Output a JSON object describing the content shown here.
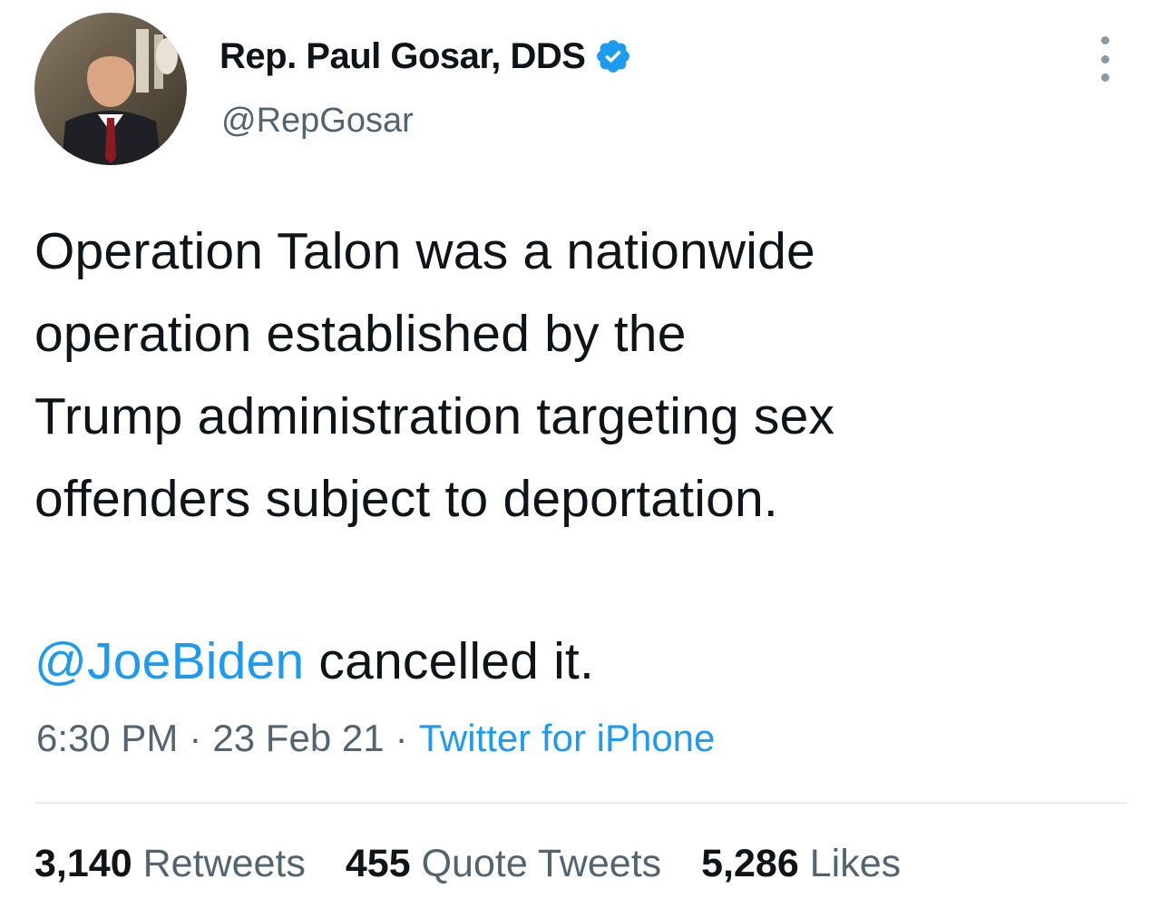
{
  "author": {
    "display_name": "Rep. Paul Gosar, DDS",
    "handle": "@RepGosar",
    "verified_icon": "verified-badge-icon"
  },
  "tweet": {
    "lines": [
      "Operation Talon was a nationwide",
      "operation established by the",
      "Trump administration targeting sex",
      "offenders subject to deportation."
    ],
    "mention": "@JoeBiden",
    "mention_tail": " cancelled it."
  },
  "meta": {
    "time": "6:30 PM",
    "separator": "·",
    "date": "23 Feb 21",
    "source": "Twitter for iPhone"
  },
  "stats": {
    "retweets_count": "3,140",
    "retweets_label": "Retweets",
    "quotes_count": "455",
    "quotes_label": "Quote Tweets",
    "likes_count": "5,286",
    "likes_label": "Likes"
  },
  "colors": {
    "accent": "#1d9bf0",
    "text_primary": "#0f1419",
    "text_secondary": "#536471",
    "divider": "#e6ecf0"
  }
}
